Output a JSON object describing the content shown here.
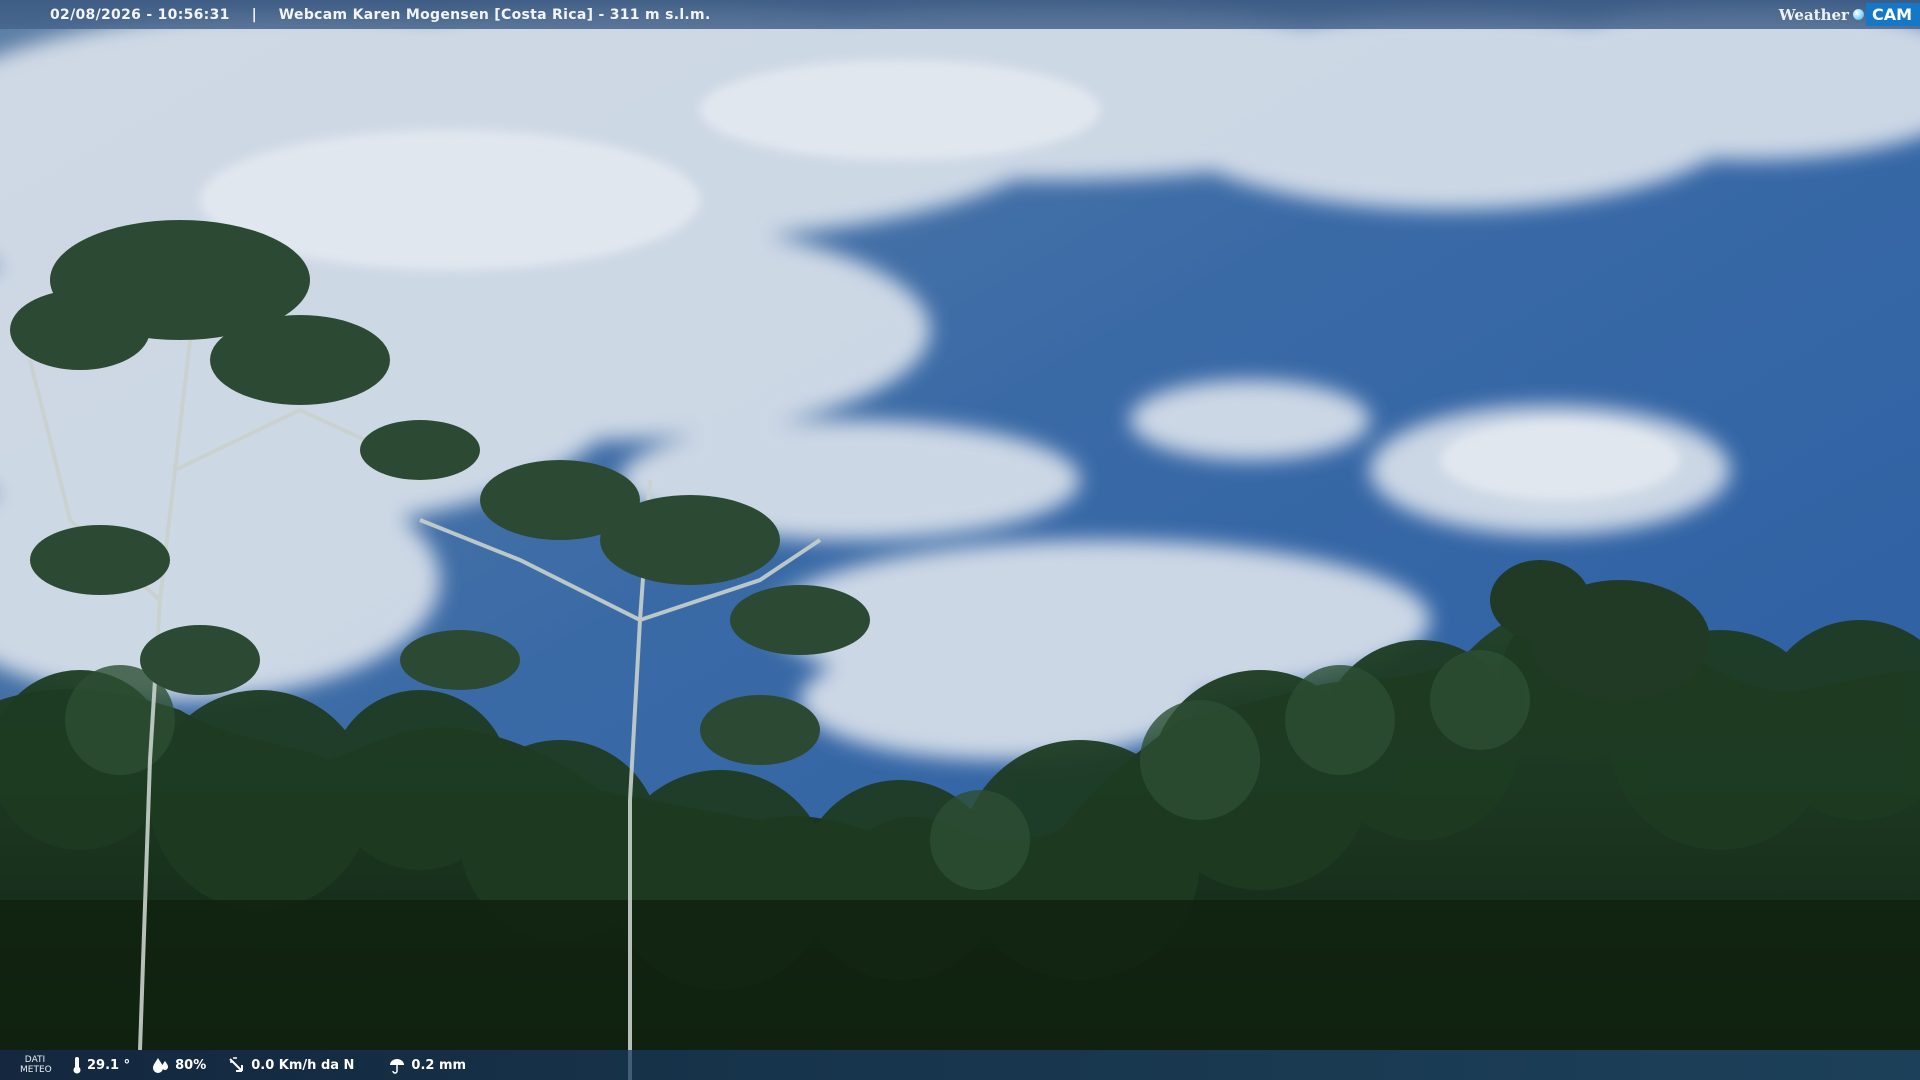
{
  "header": {
    "timestamp": "02/08/2026 - 10:56:31",
    "separator": "|",
    "title": "Webcam Karen Mogensen [Costa Rica] - 311 m s.l.m."
  },
  "logo": {
    "word": "Weather",
    "cam": "CAM"
  },
  "meteo": {
    "label_line1": "DATI",
    "label_line2": "METEO",
    "temperature": "29.1 °",
    "humidity": "80%",
    "wind": "0.0 Km/h da N",
    "rain": "0.2 mm",
    "icons": [
      "thermometer-icon",
      "humidity-icon",
      "wind-icon",
      "rain-icon"
    ]
  },
  "colors": {
    "sky": "#2f62a4",
    "cloud": "#dfe6ee",
    "foliage": "#1d3a1f"
  }
}
